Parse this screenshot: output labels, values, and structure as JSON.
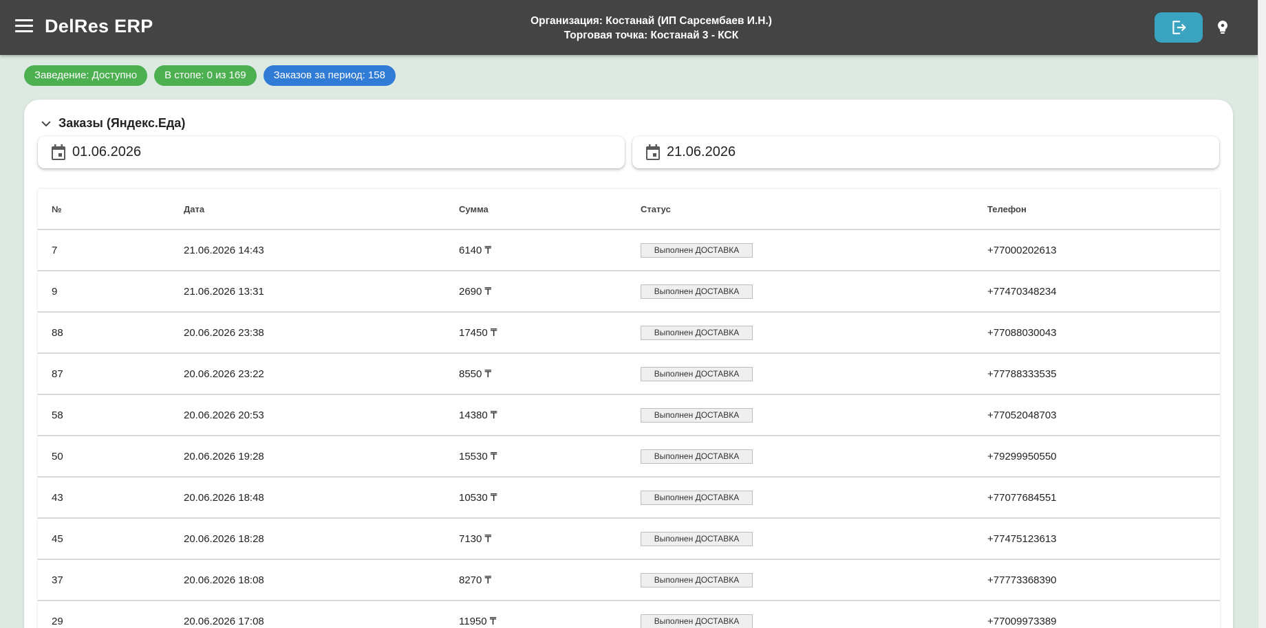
{
  "app": {
    "title": "DelRes ERP",
    "organization": "Организация: Костанай (ИП Сарсембаев И.Н.)",
    "outlet": "Торговая точка: Костанай 3 - КСК",
    "menu_icon": "hamburger-menu-icon",
    "logout_icon": "logout-icon",
    "theme_icon": "lightbulb-icon"
  },
  "chips": {
    "venue": "Заведение: Доступно",
    "stoplist": "В стопе: 0 из 169",
    "orders": "Заказов за период: 158"
  },
  "orders": {
    "title": "Заказы (Яндекс.Еда)",
    "date_from": "01.06.2026",
    "date_to": "21.06.2026",
    "columns": {
      "num": "№",
      "date": "Дата",
      "sum": "Сумма",
      "status": "Статус",
      "phone": "Телефон"
    },
    "rows": [
      {
        "num": "7",
        "date": "21.06.2026 14:43",
        "sum": "6140 ₸",
        "status": "Выполнен ДОСТАВКА",
        "phone": "+77000202613"
      },
      {
        "num": "9",
        "date": "21.06.2026 13:31",
        "sum": "2690 ₸",
        "status": "Выполнен ДОСТАВКА",
        "phone": "+77470348234"
      },
      {
        "num": "88",
        "date": "20.06.2026 23:38",
        "sum": "17450 ₸",
        "status": "Выполнен ДОСТАВКА",
        "phone": "+77088030043"
      },
      {
        "num": "87",
        "date": "20.06.2026 23:22",
        "sum": "8550 ₸",
        "status": "Выполнен ДОСТАВКА",
        "phone": "+77788333535"
      },
      {
        "num": "58",
        "date": "20.06.2026 20:53",
        "sum": "14380 ₸",
        "status": "Выполнен ДОСТАВКА",
        "phone": "+77052048703"
      },
      {
        "num": "50",
        "date": "20.06.2026 19:28",
        "sum": "15530 ₸",
        "status": "Выполнен ДОСТАВКА",
        "phone": "+79299950550"
      },
      {
        "num": "43",
        "date": "20.06.2026 18:48",
        "sum": "10530 ₸",
        "status": "Выполнен ДОСТАВКА",
        "phone": "+77077684551"
      },
      {
        "num": "45",
        "date": "20.06.2026 18:28",
        "sum": "7130 ₸",
        "status": "Выполнен ДОСТАВКА",
        "phone": "+77475123613"
      },
      {
        "num": "37",
        "date": "20.06.2026 18:08",
        "sum": "8270 ₸",
        "status": "Выполнен ДОСТАВКА",
        "phone": "+77773368390"
      },
      {
        "num": "29",
        "date": "20.06.2026 17:08",
        "sum": "11950 ₸",
        "status": "Выполнен ДОСТАВКА",
        "phone": "+77009973389"
      }
    ]
  }
}
